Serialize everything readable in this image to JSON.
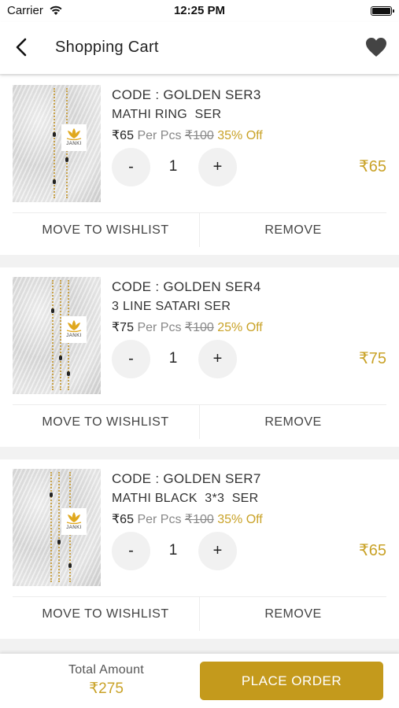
{
  "status_bar": {
    "carrier": "Carrier",
    "time": "12:25 PM"
  },
  "nav": {
    "title": "Shopping Cart",
    "back_icon": "chevron-left-icon",
    "wishlist_icon": "heart-icon"
  },
  "cart_items": [
    {
      "code": "CODE : GOLDEN SER3",
      "name": "MATHI RING  SER",
      "price": "₹65",
      "per_unit": "Per Pcs",
      "mrp": "₹100",
      "discount": "35% Off",
      "qty_minus": "-",
      "quantity": "1",
      "qty_plus": "+",
      "line_total": "₹65",
      "move_to_wishlist": "MOVE TO WISHLIST",
      "remove": "REMOVE",
      "image_logo": "JANKI"
    },
    {
      "code": "CODE : GOLDEN SER4",
      "name": "3 LINE SATARI SER",
      "price": "₹75",
      "per_unit": "Per Pcs",
      "mrp": "₹100",
      "discount": "25% Off",
      "qty_minus": "-",
      "quantity": "1",
      "qty_plus": "+",
      "line_total": "₹75",
      "move_to_wishlist": "MOVE TO WISHLIST",
      "remove": "REMOVE",
      "image_logo": "JANKI"
    },
    {
      "code": "CODE : GOLDEN SER7",
      "name": "MATHI BLACK  3*3  SER",
      "price": "₹65",
      "per_unit": "Per Pcs",
      "mrp": "₹100",
      "discount": "35% Off",
      "qty_minus": "-",
      "quantity": "1",
      "qty_plus": "+",
      "line_total": "₹65",
      "move_to_wishlist": "MOVE TO WISHLIST",
      "remove": "REMOVE",
      "image_logo": "JANKI"
    }
  ],
  "footer": {
    "total_label": "Total Amount",
    "total_value": "₹275",
    "place_order": "PLACE ORDER"
  },
  "colors": {
    "accent": "#c9a227",
    "button": "#c49a1c"
  }
}
